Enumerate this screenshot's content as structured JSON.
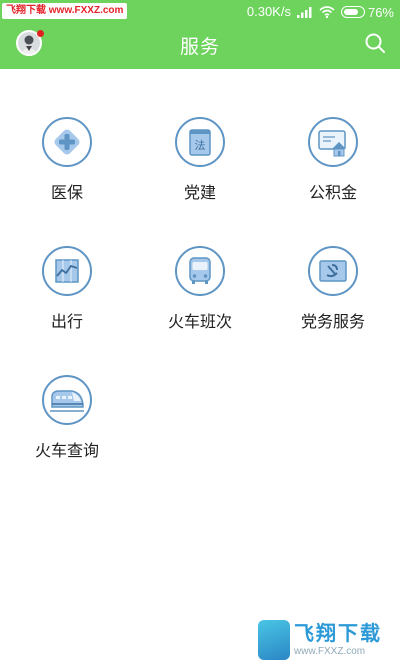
{
  "status_bar": {
    "watermark": "飞翔下载 www.FXXZ.com",
    "net_speed": "0.30K/s",
    "battery": "76%",
    "battery_level": 0.76
  },
  "header": {
    "title": "服务"
  },
  "services": [
    {
      "label": "医保",
      "icon": "medical-cross-icon"
    },
    {
      "label": "党建",
      "icon": "law-book-icon"
    },
    {
      "label": "公积金",
      "icon": "housing-fund-icon"
    },
    {
      "label": "出行",
      "icon": "travel-chart-icon"
    },
    {
      "label": "火车班次",
      "icon": "bus-icon"
    },
    {
      "label": "党务服务",
      "icon": "party-flag-icon"
    },
    {
      "label": "火车查询",
      "icon": "bullet-train-icon"
    }
  ],
  "footer_watermark": {
    "text": "飞翔下载",
    "url": "www.FXXZ.com"
  },
  "colors": {
    "header_bg": "#6dd35d",
    "icon_stroke": "#5f95c4",
    "icon_fill": "#a6c8ea"
  }
}
